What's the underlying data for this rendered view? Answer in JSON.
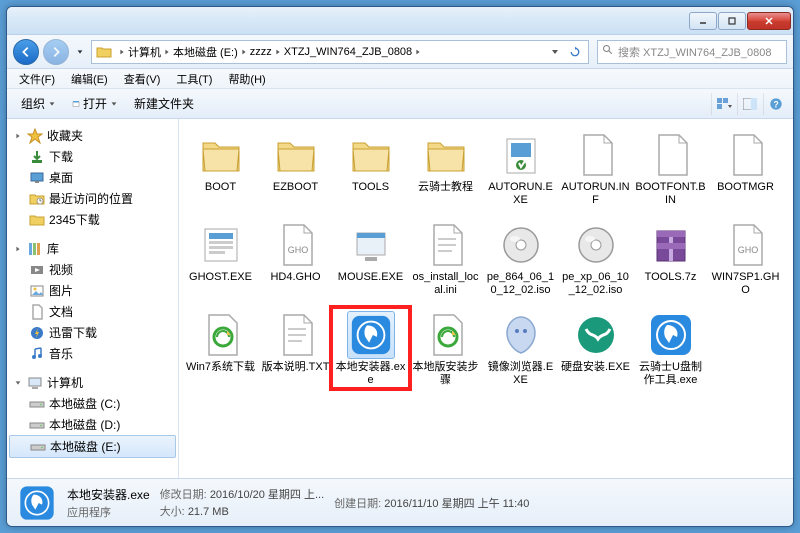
{
  "breadcrumb": [
    "计算机",
    "本地磁盘 (E:)",
    "zzzz",
    "XTZJ_WIN764_ZJB_0808"
  ],
  "search": {
    "placeholder": "搜索 XTZJ_WIN764_ZJB_0808"
  },
  "menu": {
    "file": "文件(F)",
    "edit": "编辑(E)",
    "view": "查看(V)",
    "tools": "工具(T)",
    "help": "帮助(H)"
  },
  "toolbar": {
    "organize": "组织",
    "open": "打开",
    "newfolder": "新建文件夹"
  },
  "sidebar": {
    "favorites": {
      "label": "收藏夹",
      "items": [
        "下载",
        "桌面",
        "最近访问的位置",
        "2345下载"
      ]
    },
    "libraries": {
      "label": "库",
      "items": [
        "视频",
        "图片",
        "文档",
        "迅雷下载",
        "音乐"
      ]
    },
    "computer": {
      "label": "计算机",
      "items": [
        "本地磁盘 (C:)",
        "本地磁盘 (D:)",
        "本地磁盘 (E:)"
      ],
      "selected": 2
    }
  },
  "files": [
    {
      "name": "BOOT",
      "type": "folder"
    },
    {
      "name": "EZBOOT",
      "type": "folder"
    },
    {
      "name": "TOOLS",
      "type": "folder"
    },
    {
      "name": "云骑士教程",
      "type": "folder"
    },
    {
      "name": "AUTORUN.EXE",
      "type": "exe-setup"
    },
    {
      "name": "AUTORUN.INF",
      "type": "file"
    },
    {
      "name": "BOOTFONT.BIN",
      "type": "file"
    },
    {
      "name": "BOOTMGR",
      "type": "file"
    },
    {
      "name": "GHOST.EXE",
      "type": "exe-ghost"
    },
    {
      "name": "HD4.GHO",
      "type": "gho"
    },
    {
      "name": "MOUSE.EXE",
      "type": "exe-generic"
    },
    {
      "name": "os_install_local.ini",
      "type": "ini"
    },
    {
      "name": "pe_864_06_10_12_02.iso",
      "type": "iso"
    },
    {
      "name": "pe_xp_06_10_12_02.iso",
      "type": "iso"
    },
    {
      "name": "TOOLS.7z",
      "type": "archive"
    },
    {
      "name": "WIN7SP1.GHO",
      "type": "gho"
    },
    {
      "name": "Win7系统下载",
      "type": "url"
    },
    {
      "name": "版本说明.TXT",
      "type": "txt"
    },
    {
      "name": "本地安装器.exe",
      "type": "exe-installer",
      "highlighted": true
    },
    {
      "name": "本地版安装步骤",
      "type": "url"
    },
    {
      "name": "镜像浏览器.EXE",
      "type": "exe-imgview"
    },
    {
      "name": "硬盘安装.EXE",
      "type": "exe-diskinst"
    },
    {
      "name": "云骑士U盘制作工具.exe",
      "type": "exe-installer"
    }
  ],
  "selected": {
    "name": "本地安装器.exe",
    "type": "应用程序",
    "modified_label": "修改日期:",
    "modified": "2016/10/20 星期四 上...",
    "created_label": "创建日期:",
    "created": "2016/11/10 星期四 上午 11:40",
    "size_label": "大小:",
    "size": "21.7 MB"
  }
}
